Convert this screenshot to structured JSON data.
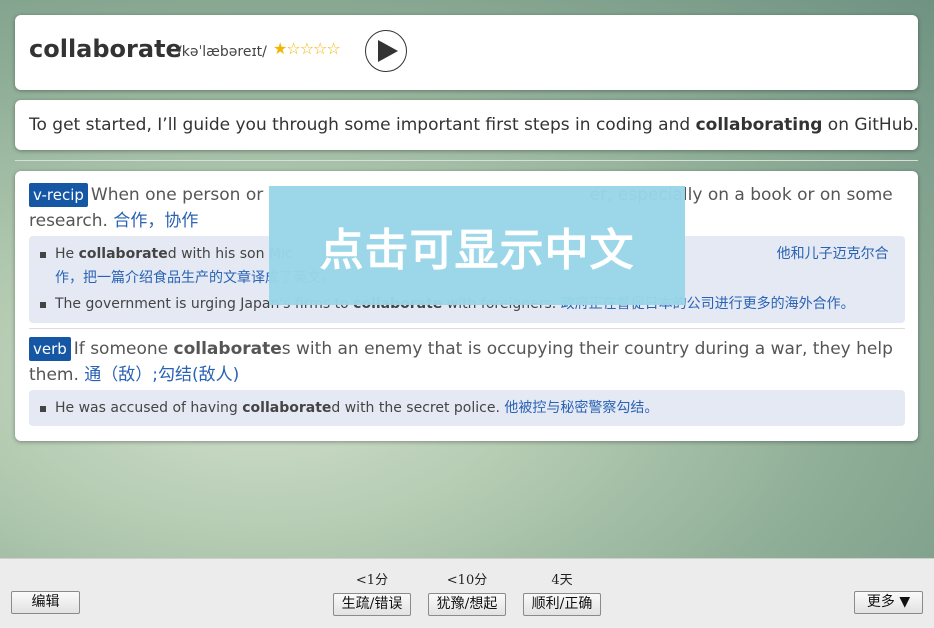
{
  "word": {
    "headword": "collaborate",
    "phonetic": "/kəˈlæbəreɪt/",
    "stars": "★☆☆☆☆"
  },
  "context_sentence": {
    "before": "To get started, I’ll guide you through some important first steps in coding and ",
    "highlight": "collaborating",
    "after": " on GitHub."
  },
  "senses": [
    {
      "pos": "v-recip",
      "definition_visible": "When one person or ",
      "definition_tail": "er, especially on a book or on some research.",
      "translation": "合作，协作",
      "examples": [
        {
          "before": "He ",
          "highlight": "collaborate",
          "after": "d with his son Mic",
          "translation": "他和儿子迈克尔合作，把一篇介绍食品生产的文章译成了英文。"
        },
        {
          "before": "The government is urging Japan's firms to ",
          "highlight": "collaborate",
          "after": " with foreigners.",
          "translation": "政府正在督促日本的公司进行更多的海外合作。"
        }
      ]
    },
    {
      "pos": "verb",
      "definition_before": "If someone ",
      "definition_highlight": "collaborate",
      "definition_after": "s with an enemy that is occupying their country during a war, they help them.",
      "translation": "通（敌）;勾结(敌人)",
      "examples": [
        {
          "before": "He was accused of having ",
          "highlight": "collaborate",
          "after": "d with the secret police.",
          "translation": "他被控与秘密警察勾结。"
        }
      ]
    }
  ],
  "overlay_text": "点击可显示中文",
  "bottom": {
    "edit_label": "编辑",
    "more_label": "更多 ▼",
    "answers": [
      {
        "interval": "<1分",
        "label": "生疏/错误"
      },
      {
        "interval": "<10分",
        "label": "犹豫/想起"
      },
      {
        "interval": "4天",
        "label": "顺利/正确"
      }
    ]
  },
  "colors": {
    "pos_badge": "#1557a5",
    "translation": "#2a63b5",
    "star": "#f2b600",
    "overlay": "#98d6e8"
  }
}
